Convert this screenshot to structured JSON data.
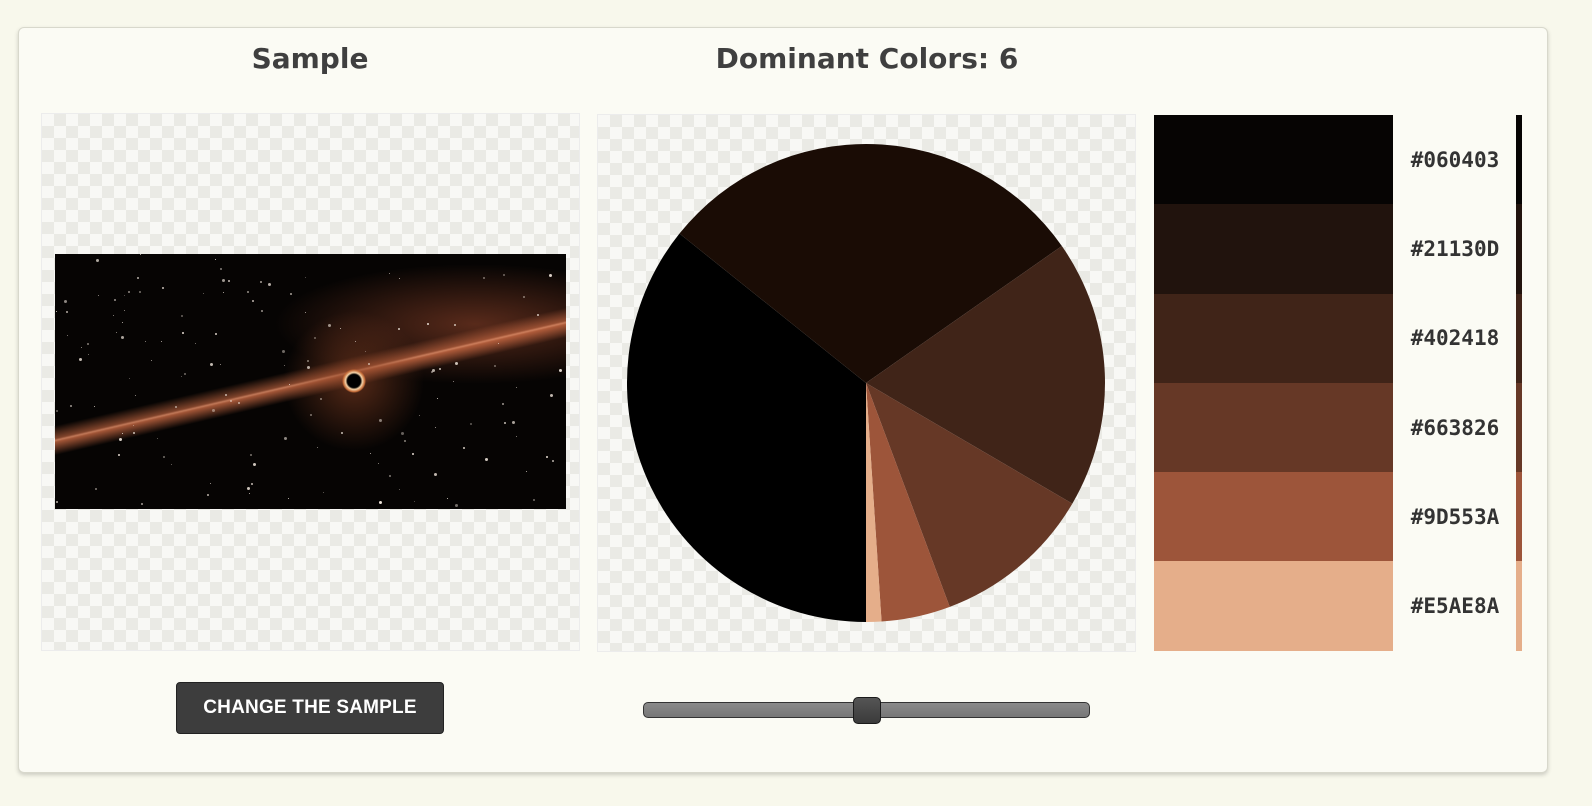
{
  "sample": {
    "heading": "Sample",
    "button_label": "CHANGE THE SAMPLE"
  },
  "colors": {
    "heading": "Dominant Colors: 6",
    "count": 6,
    "slider_value_fraction": 0.5,
    "palette": [
      {
        "hex": "#060403",
        "label": "#060403"
      },
      {
        "hex": "#21130D",
        "label": "#21130D"
      },
      {
        "hex": "#402418",
        "label": "#402418"
      },
      {
        "hex": "#663826",
        "label": "#663826"
      },
      {
        "hex": "#9D553A",
        "label": "#9D553A"
      },
      {
        "hex": "#E5AE8A",
        "label": "#E5AE8A"
      }
    ]
  },
  "chart_data": {
    "type": "pie",
    "values": [
      0.345,
      0.285,
      0.175,
      0.105,
      0.045,
      0.01
    ],
    "colors": [
      "#000000",
      "#1a0c05",
      "#402418",
      "#663826",
      "#9D553A",
      "#E5AE8A"
    ]
  }
}
